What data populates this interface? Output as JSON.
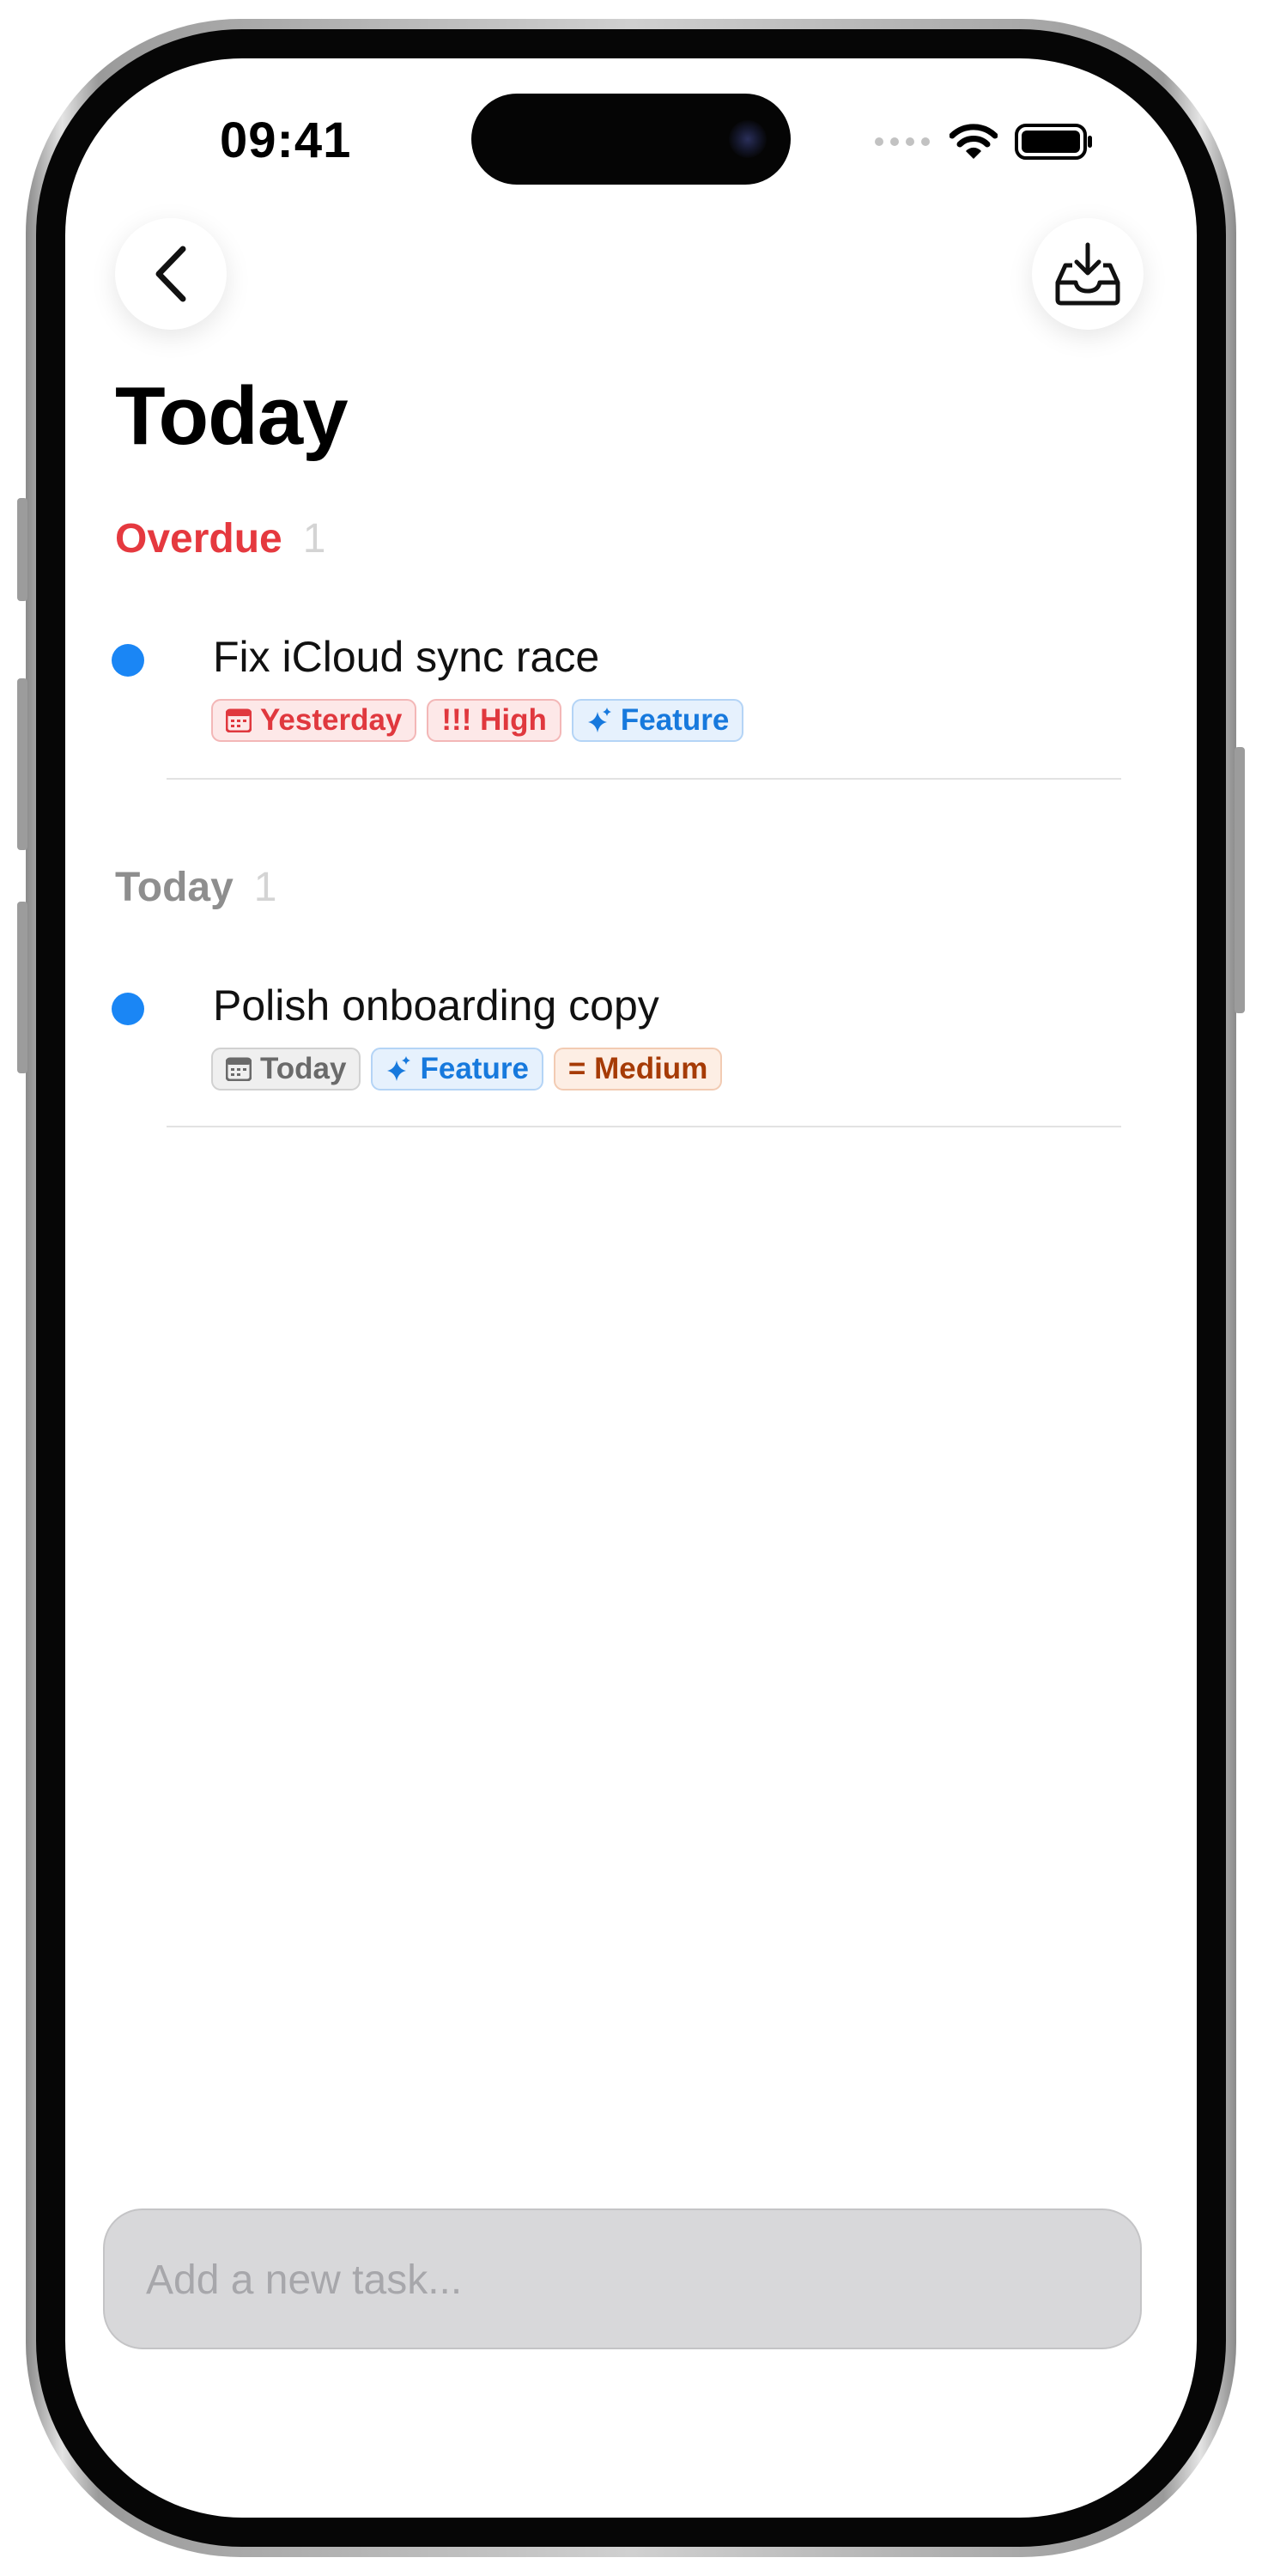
{
  "status_bar": {
    "time": "09:41",
    "icons": [
      "signal-dots-icon",
      "wifi-icon",
      "battery-icon"
    ]
  },
  "nav": {
    "back_icon": "chevron-left-icon",
    "inbox_icon": "tray-download-icon"
  },
  "page": {
    "title": "Today"
  },
  "sections": [
    {
      "name": "Overdue",
      "count": "1",
      "color": "#e5393f",
      "tasks": [
        {
          "title": "Fix iCloud sync race",
          "dot_color": "#1a86f5",
          "chips": [
            {
              "icon": "calendar-icon",
              "label": "Yesterday",
              "style": "red"
            },
            {
              "icon": "",
              "label": "!!! High",
              "style": "red"
            },
            {
              "icon": "sparkle-icon",
              "label": "Feature",
              "style": "blue"
            }
          ]
        }
      ]
    },
    {
      "name": "Today",
      "count": "1",
      "color": "#8e8e8e",
      "tasks": [
        {
          "title": "Polish onboarding copy",
          "dot_color": "#1a86f5",
          "chips": [
            {
              "icon": "calendar-icon",
              "label": "Today",
              "style": "gray"
            },
            {
              "icon": "sparkle-icon",
              "label": "Feature",
              "style": "blue"
            },
            {
              "icon": "",
              "label": "= Medium",
              "style": "orange"
            }
          ]
        }
      ]
    }
  ],
  "new_task_input": {
    "placeholder": "Add a new task...",
    "value": ""
  }
}
